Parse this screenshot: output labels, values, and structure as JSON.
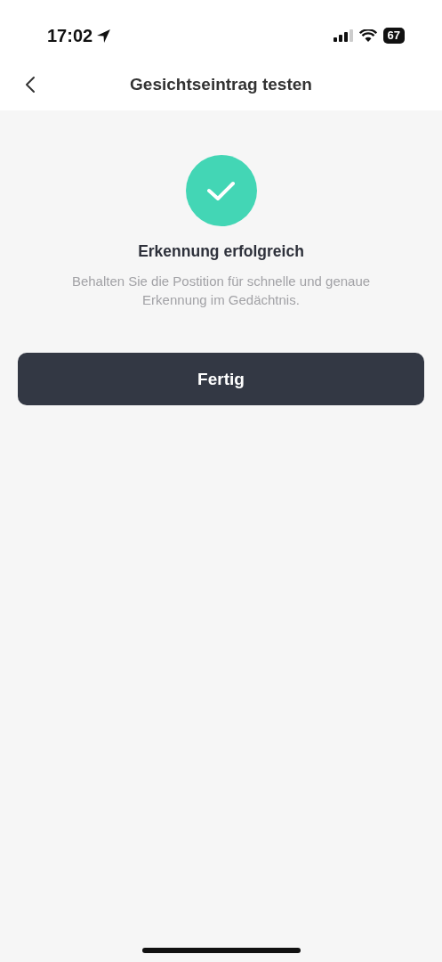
{
  "status_bar": {
    "time": "17:02",
    "battery": "67"
  },
  "nav_bar": {
    "title": "Gesichtseintrag testen"
  },
  "result": {
    "title": "Erkennung erfolgreich",
    "description": "Behalten Sie die Postition für schnelle und genaue Erkennung im Gedächtnis."
  },
  "buttons": [
    "Fertig"
  ]
}
